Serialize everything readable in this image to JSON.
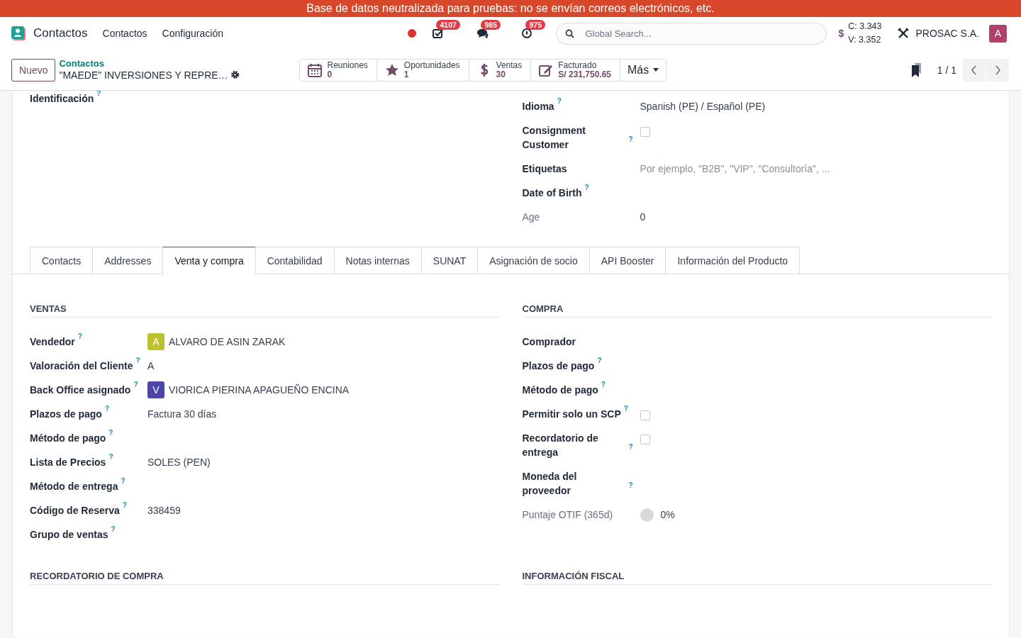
{
  "banner": "Base de datos neutralizada para pruebas: no se envían correos electrónicos, etc.",
  "navbar": {
    "app_name": "Contactos",
    "menu": [
      "Contactos",
      "Configuración"
    ],
    "systray": [
      {
        "kind": "recording"
      },
      {
        "kind": "activity",
        "count": "4107"
      },
      {
        "kind": "messages",
        "count": "985"
      },
      {
        "kind": "timer",
        "count": "975"
      }
    ],
    "search": {
      "placeholder": "Global Search..."
    },
    "currency_symbol": "$",
    "rates": [
      "C: 3.343",
      "V: 3.352"
    ],
    "company": "PROSAC S.A.",
    "user_avatar": "A"
  },
  "control_panel": {
    "new_button": "Nuevo",
    "breadcrumb": "Contactos",
    "record_name": "\"MAEDE\" INVERSIONES Y REPRE…",
    "smart_buttons": [
      {
        "kind": "calendar",
        "label": "Reuniones",
        "value": "0"
      },
      {
        "kind": "star",
        "label": "Oportunidades",
        "value": "1"
      },
      {
        "kind": "dollar",
        "label": "Ventas",
        "value": "30"
      },
      {
        "kind": "invoice",
        "label": "Facturado",
        "value": "S/ 231,750.65"
      }
    ],
    "more_button": "Más",
    "pager": "1 / 1"
  },
  "top_group": {
    "left": [
      {
        "label": "Identificación",
        "help": "?",
        "muted": false
      }
    ],
    "right": [
      {
        "label": "Idioma",
        "help": "?",
        "kind": "text",
        "value": "Spanish (PE) / Español (PE)",
        "muted": false
      },
      {
        "label": "Consignment Customer",
        "help": "?",
        "kind": "checkbox",
        "checked": false,
        "muted": false
      },
      {
        "label": "Etiquetas",
        "kind": "placeholder",
        "placeholder": "Por ejemplo, \"B2B\", \"VIP\", \"Consultoría\", ...",
        "muted": false
      },
      {
        "label": "Date of Birth",
        "help": "?",
        "muted": false
      },
      {
        "label": "Age",
        "kind": "text",
        "value": "0",
        "muted": true
      }
    ]
  },
  "tabs": [
    {
      "label": "Contacts",
      "selected": false
    },
    {
      "label": "Addresses",
      "selected": false
    },
    {
      "label": "Venta y compra",
      "selected": true
    },
    {
      "label": "Contabilidad",
      "selected": false
    },
    {
      "label": "Notas internas",
      "selected": false
    },
    {
      "label": "SUNAT",
      "selected": false
    },
    {
      "label": "Asignación de socio",
      "selected": false
    },
    {
      "label": "API Booster",
      "selected": false
    },
    {
      "label": "Información del Producto",
      "selected": false
    }
  ],
  "sections": [
    {
      "title": "VENTAS",
      "fields": [
        {
          "label": "Vendedor",
          "help": "?",
          "kind": "avatar",
          "initial": "A",
          "color": "#bcc12c",
          "value": "ALVARO DE ASIN ZARAK",
          "muted": false
        },
        {
          "label": "Valoración del Cliente",
          "help": "?",
          "kind": "text",
          "value": "A",
          "muted": false
        },
        {
          "label": "Back Office asignado",
          "help": "?",
          "kind": "avatar",
          "initial": "V",
          "color": "#4c46a8",
          "value": "VIORICA PIERINA APAGUEÑO ENCINA",
          "muted": false
        },
        {
          "label": "Plazos de pago",
          "help": "?",
          "kind": "text",
          "value": "Factura 30 días",
          "muted": false
        },
        {
          "label": "Método de pago",
          "help": "?",
          "muted": false
        },
        {
          "label": "Lista de Precios",
          "help": "?",
          "kind": "text",
          "value": "SOLES (PEN)",
          "muted": false
        },
        {
          "label": "Método de entrega",
          "help": "?",
          "muted": false
        },
        {
          "label": "Código de Reserva",
          "help": "?",
          "kind": "text",
          "value": "338459",
          "muted": false
        },
        {
          "label": "Grupo de ventas",
          "help": "?",
          "muted": false
        }
      ]
    },
    {
      "title": "COMPRA",
      "fields": [
        {
          "label": "Comprador",
          "muted": false
        },
        {
          "label": "Plazos de pago",
          "help": "?",
          "muted": false
        },
        {
          "label": "Método de pago",
          "help": "?",
          "muted": false
        },
        {
          "label": "Permitir solo un SCP",
          "help": "?",
          "kind": "checkbox",
          "checked": false,
          "muted": false
        },
        {
          "label": "Recordatorio de entrega",
          "help": "?",
          "kind": "checkbox",
          "checked": false,
          "muted": false
        },
        {
          "label": "Moneda del proveedor",
          "help": "?",
          "muted": false
        },
        {
          "label": "Puntaje OTIF (365d)",
          "kind": "score",
          "level": 0,
          "value": "0%",
          "muted": true
        }
      ]
    },
    {
      "title": "RECORDATORIO DE COMPRA"
    },
    {
      "title": "INFORMACIÓN FISCAL"
    }
  ]
}
